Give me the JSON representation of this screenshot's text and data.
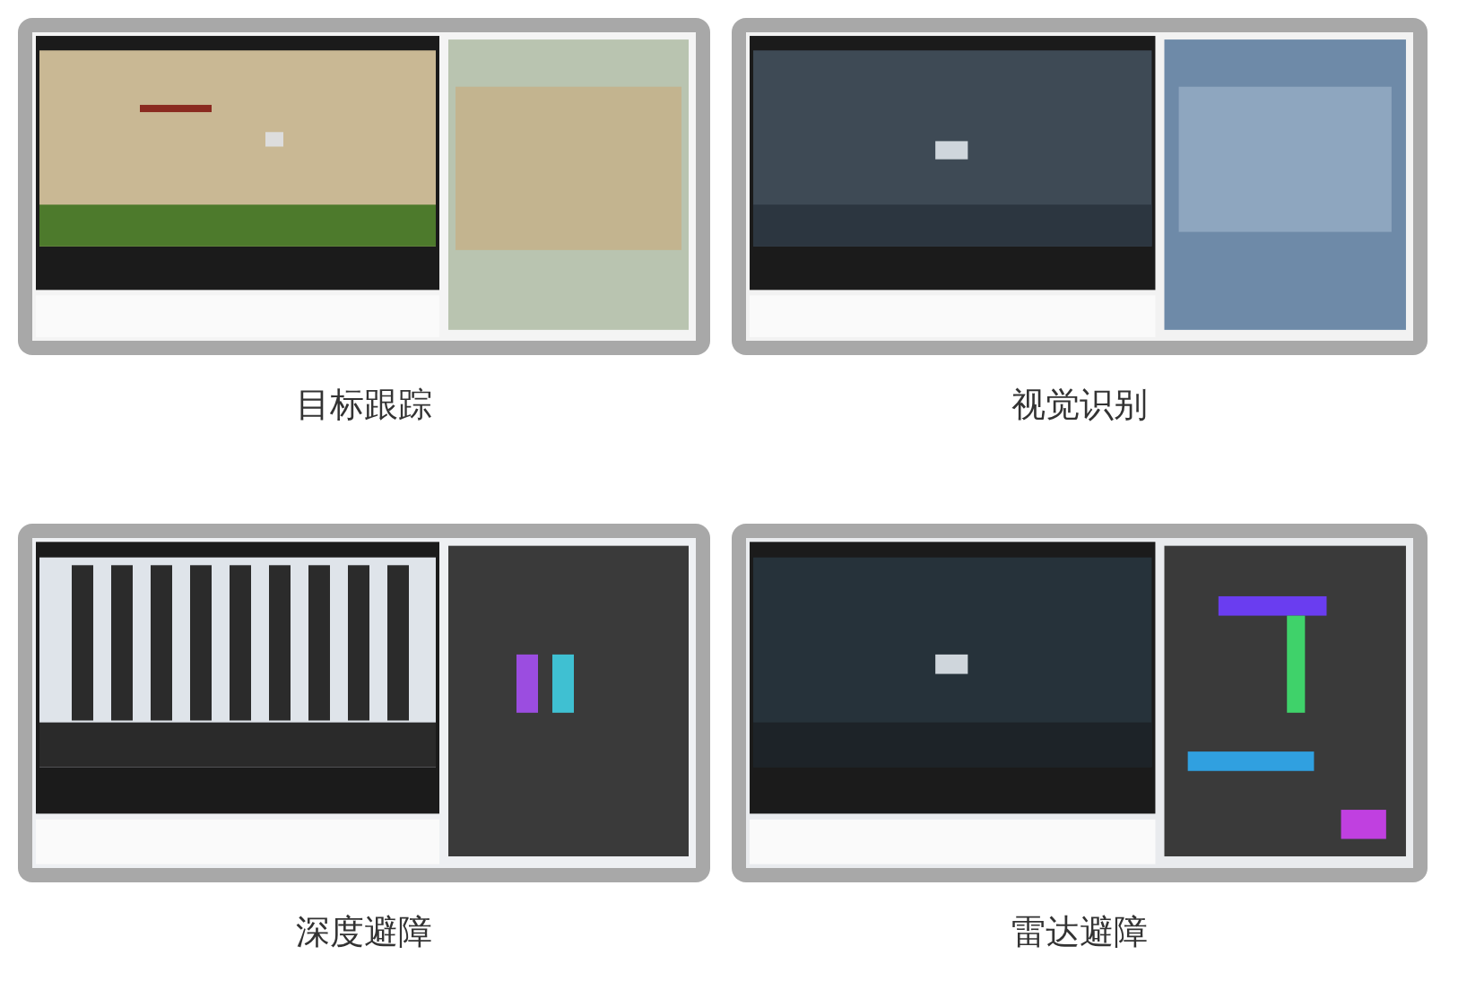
{
  "features": [
    {
      "kind": "tracking",
      "caption": "目标跟踪"
    },
    {
      "kind": "vision",
      "caption": "视觉识别"
    },
    {
      "kind": "depth",
      "caption": "深度避障"
    },
    {
      "kind": "lidar",
      "caption": "雷达避障"
    }
  ]
}
